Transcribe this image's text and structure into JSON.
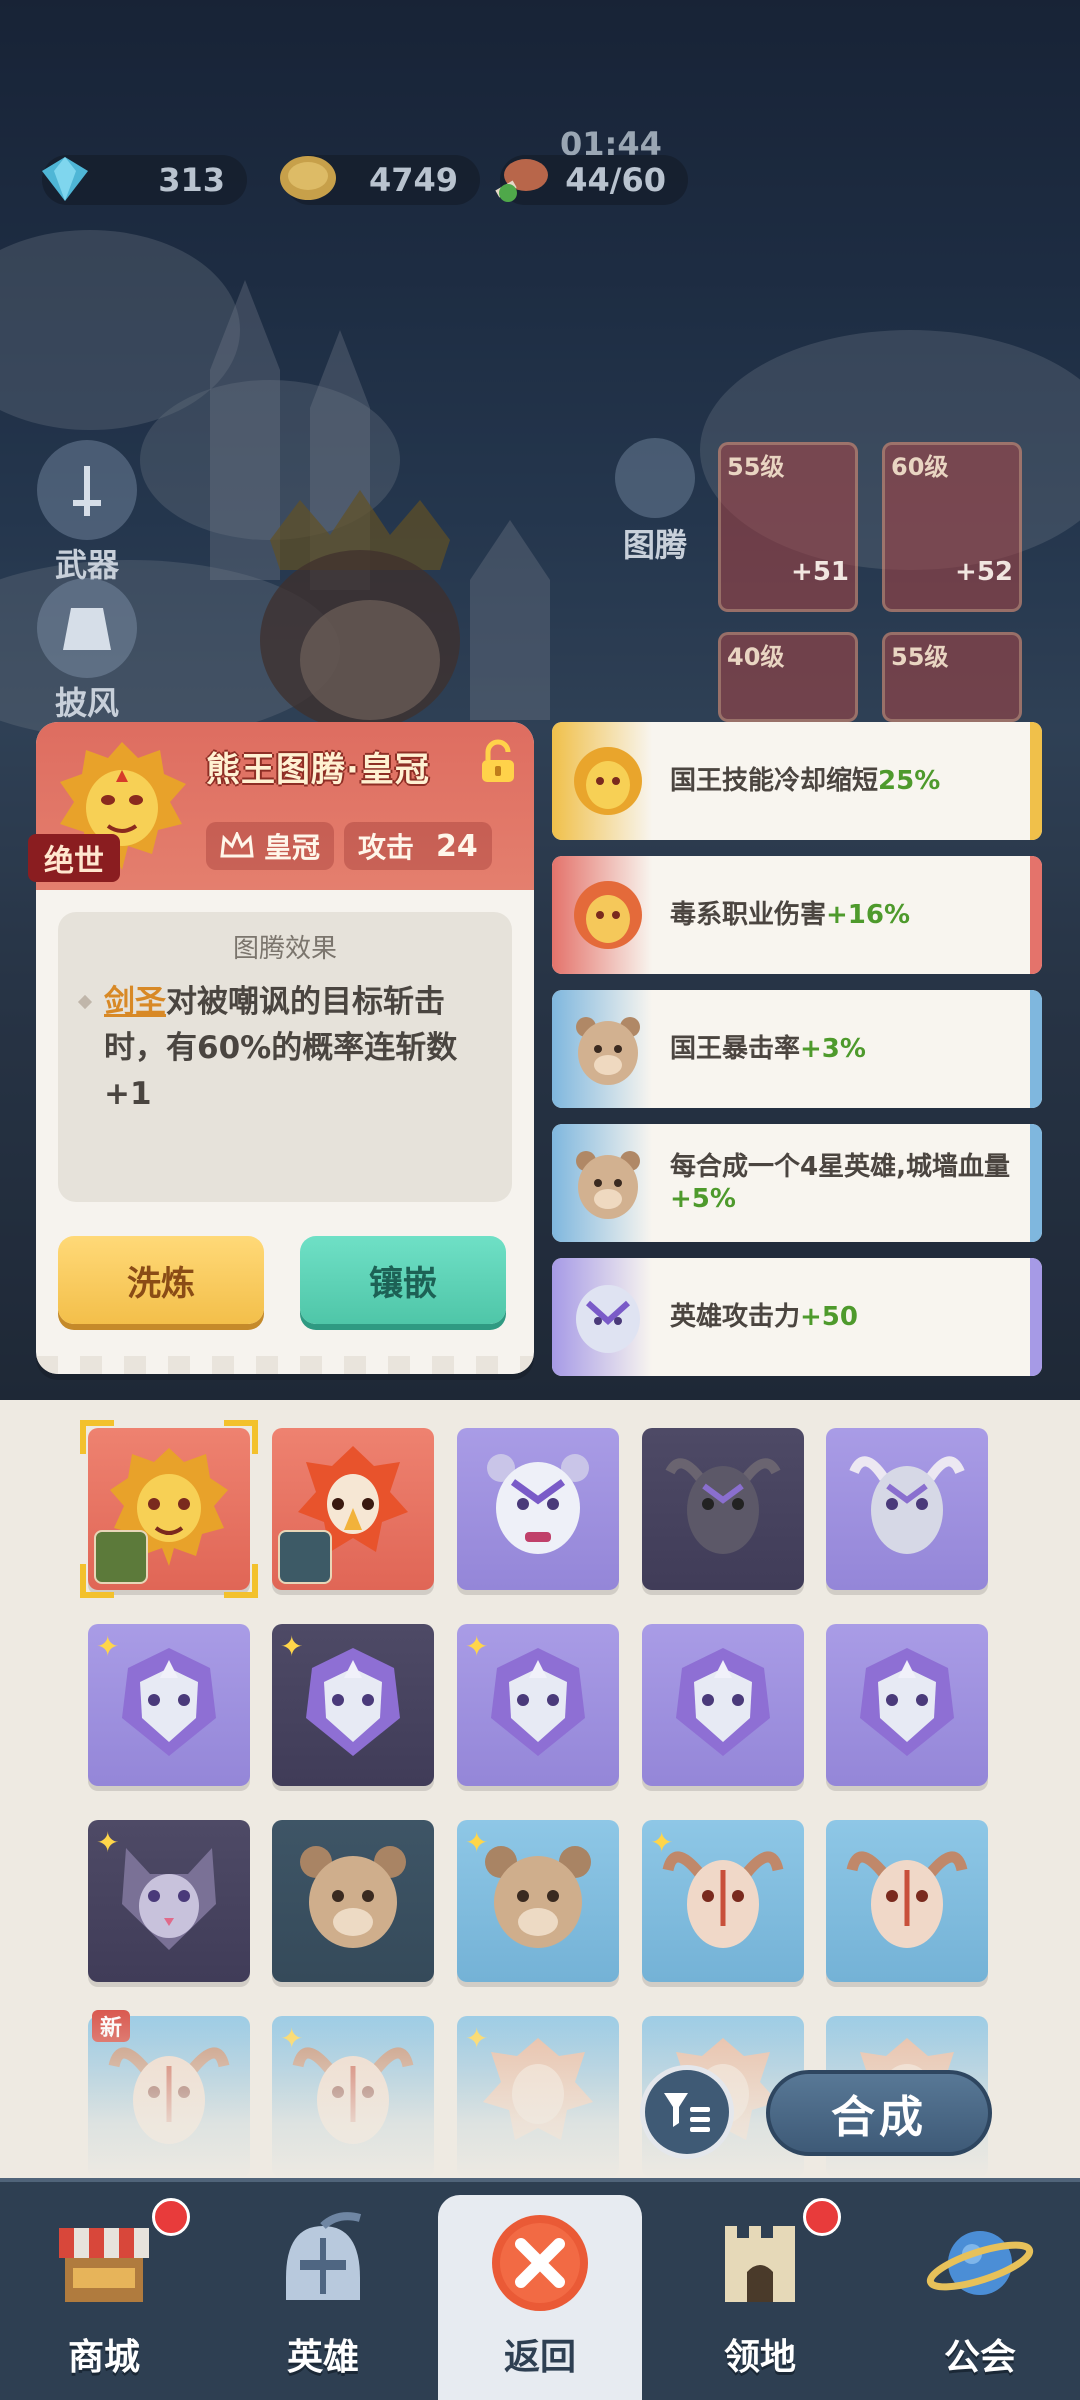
{
  "resources": {
    "gems": "313",
    "coins": "4749",
    "stamina": "44/60",
    "timer": "01:44"
  },
  "side_buttons": {
    "weapon": "武器",
    "cape": "披风",
    "totem": "图腾"
  },
  "equipment": [
    {
      "level": "55级",
      "plus": "+51"
    },
    {
      "level": "60级",
      "plus": "+52"
    },
    {
      "level": "40级",
      "plus": ""
    },
    {
      "level": "55级",
      "plus": ""
    }
  ],
  "detail": {
    "title": "熊王图腾·皇冠",
    "rarity": "绝世",
    "slot_label": "皇冠",
    "attack_label": "攻击",
    "attack_value": "24",
    "effect_title": "图腾效果",
    "effect_highlight": "剑圣",
    "effect_text": "对被嘲讽的目标斩击时，有60%的概率连斩数+1",
    "wash_button": "洗炼",
    "inlay_button": "镶嵌"
  },
  "stats": [
    {
      "text": "国王技能冷却缩短",
      "value": "25%",
      "color": "#f0c04a",
      "icon": "gold-lion-icon"
    },
    {
      "text": "毒系职业伤害",
      "value": "+16%",
      "color": "#e4736b",
      "icon": "red-lion-icon"
    },
    {
      "text": "国王暴击率",
      "value": "+3%",
      "color": "#7fb7de",
      "icon": "bear-icon"
    },
    {
      "text": "每合成一个4星英雄,城墙血量",
      "value": "+5%",
      "color": "#7fb7de",
      "icon": "bear-icon"
    },
    {
      "text": "英雄攻击力",
      "value": "+50",
      "color": "#a69ae6",
      "icon": "white-tiger-icon"
    }
  ],
  "inventory": [
    {
      "type": "gold-lion",
      "bg": "red",
      "hero": true,
      "star": false,
      "selected": true
    },
    {
      "type": "red-eagle",
      "bg": "red",
      "hero": true,
      "star": false,
      "selected": false
    },
    {
      "type": "white-tiger",
      "bg": "purple",
      "hero": false,
      "star": false,
      "selected": false
    },
    {
      "type": "dark-bull",
      "bg": "dark",
      "hero": false,
      "star": false,
      "selected": false
    },
    {
      "type": "silver-bull",
      "bg": "purple",
      "hero": false,
      "star": false,
      "selected": false
    },
    {
      "type": "purple-wolf",
      "bg": "purple",
      "hero": false,
      "star": true,
      "selected": false
    },
    {
      "type": "purple-wolf",
      "bg": "dark",
      "hero": false,
      "star": true,
      "selected": false
    },
    {
      "type": "purple-wolf",
      "bg": "purple",
      "hero": false,
      "star": true,
      "selected": false
    },
    {
      "type": "purple-wolf",
      "bg": "purple",
      "hero": false,
      "star": false,
      "selected": false
    },
    {
      "type": "purple-wolf",
      "bg": "purple",
      "hero": false,
      "star": false,
      "selected": false
    },
    {
      "type": "cat",
      "bg": "dark",
      "hero": false,
      "star": true,
      "selected": false
    },
    {
      "type": "bear",
      "bg": "teal-dark",
      "hero": false,
      "star": false,
      "selected": false
    },
    {
      "type": "bear",
      "bg": "blue",
      "hero": false,
      "star": true,
      "selected": false
    },
    {
      "type": "bull-skull",
      "bg": "blue",
      "hero": false,
      "star": true,
      "selected": false
    },
    {
      "type": "bull-skull",
      "bg": "blue",
      "hero": false,
      "star": false,
      "selected": false
    },
    {
      "type": "bull-skull",
      "bg": "blue",
      "hero": false,
      "star": false,
      "selected": false,
      "new": true
    },
    {
      "type": "bull-skull",
      "bg": "blue",
      "hero": false,
      "star": true,
      "selected": false
    },
    {
      "type": "lion",
      "bg": "blue",
      "hero": false,
      "star": true,
      "selected": false
    },
    {
      "type": "lion",
      "bg": "blue",
      "hero": false,
      "star": false,
      "selected": false
    },
    {
      "type": "lion",
      "bg": "blue",
      "hero": false,
      "star": false,
      "selected": false
    }
  ],
  "new_tag": "新",
  "merge_button": "合成",
  "nav": {
    "shop": "商城",
    "heroes": "英雄",
    "back": "返回",
    "territory": "领地",
    "guild": "公会"
  }
}
